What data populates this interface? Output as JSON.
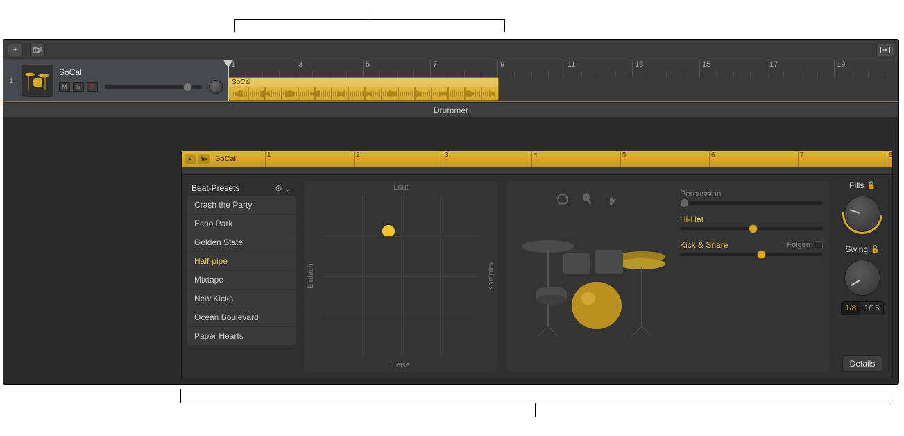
{
  "track": {
    "number": "1",
    "name": "SoCal",
    "mute": "M",
    "solo": "S",
    "record": "R"
  },
  "toolbar": {
    "add": "+"
  },
  "ruler_marks": [
    "1",
    "3",
    "5",
    "7",
    "9",
    "11",
    "13",
    "15",
    "17",
    "19"
  ],
  "region": {
    "name": "SoCal"
  },
  "pane_title": "Drummer",
  "editor": {
    "region_name": "SoCal",
    "ruler_marks": [
      "1",
      "2",
      "3",
      "4",
      "5",
      "6",
      "7",
      "8"
    ]
  },
  "presets": {
    "header": "Beat-Presets",
    "items": [
      "Crash the Party",
      "Echo Park",
      "Golden State",
      "Half-pipe",
      "Mixtape",
      "New Kicks",
      "Ocean Boulevard",
      "Paper Hearts"
    ],
    "selected": "Half-pipe"
  },
  "xy": {
    "top": "Laut",
    "bottom": "Leise",
    "left": "Einfach",
    "right": "Komplex"
  },
  "kit_sliders": {
    "percussion": "Percussion",
    "hihat": "Hi-Hat",
    "kicksnare": "Kick & Snare",
    "follow": "Folgen"
  },
  "knobs": {
    "fills": "Fills",
    "swing": "Swing",
    "swing_a": "1/8",
    "swing_b": "1/16",
    "details": "Details"
  }
}
